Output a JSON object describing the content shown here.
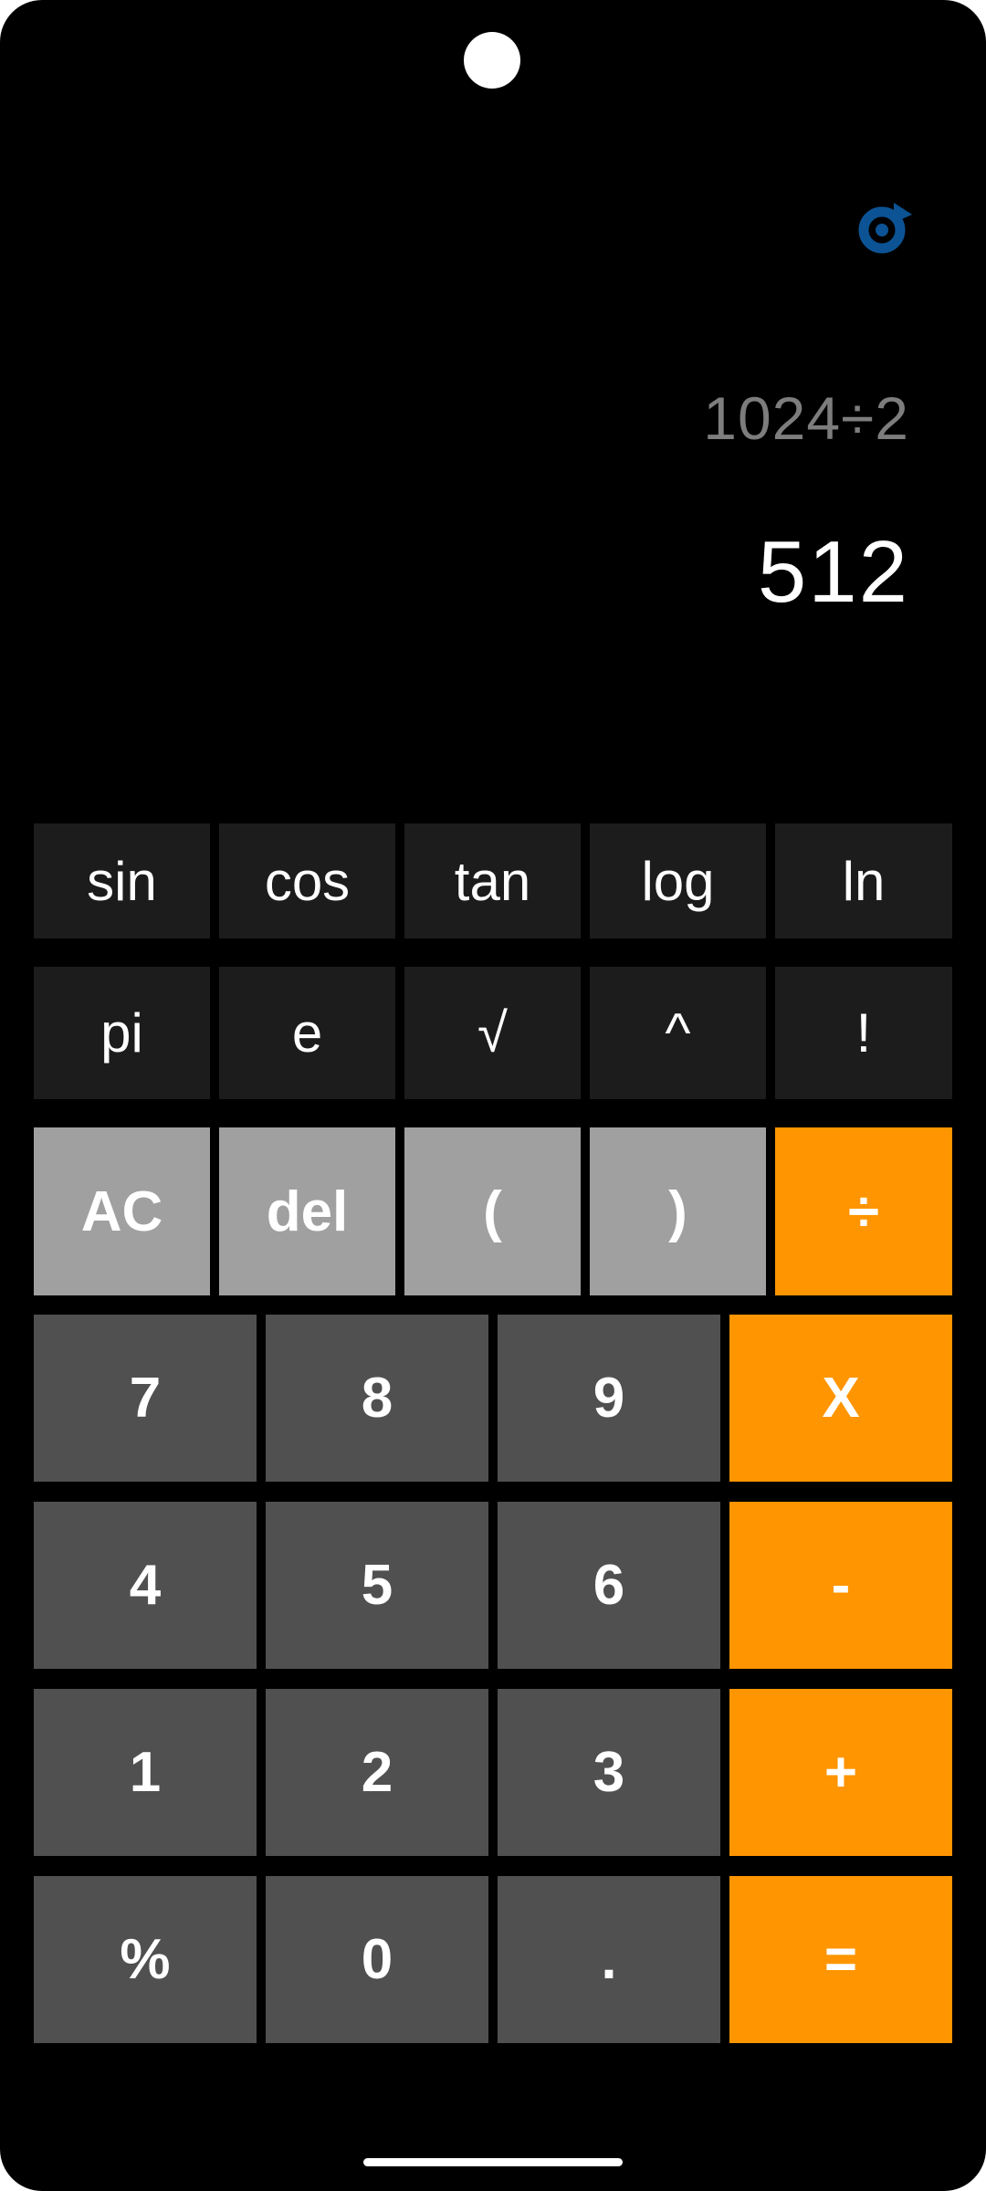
{
  "display": {
    "expression": "1024÷2",
    "result": "512"
  },
  "icons": {
    "refresh": "refresh-icon",
    "accent_color": "#0b5394"
  },
  "buttons": {
    "scientific_row1": [
      "sin",
      "cos",
      "tan",
      "log",
      "ln"
    ],
    "scientific_row2": [
      "pi",
      "e",
      "√",
      "^",
      "!"
    ],
    "utility_row": [
      "AC",
      "del",
      "(",
      ")"
    ],
    "divide": "÷",
    "digits_row1": [
      "7",
      "8",
      "9"
    ],
    "multiply": "X",
    "digits_row2": [
      "4",
      "5",
      "6"
    ],
    "subtract": "-",
    "digits_row3": [
      "1",
      "2",
      "3"
    ],
    "add": "+",
    "bottom_row": [
      "%",
      "0",
      "."
    ],
    "equals": "="
  },
  "colors": {
    "background": "#000000",
    "scientific_key": "#1c1c1c",
    "utility_key": "#a0a0a0",
    "number_key": "#505050",
    "operator_key": "#ff9500",
    "expression_text": "#7d7d7d",
    "result_text": "#ffffff"
  }
}
